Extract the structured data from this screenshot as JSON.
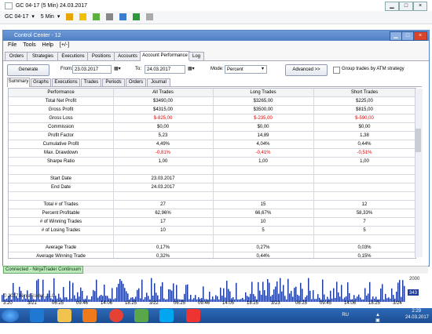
{
  "chart_window": {
    "title": "GC 04-17 (5 Min)  24.03.2017",
    "toolbar": {
      "instrument": "GC 04-17",
      "interval": "5 Min"
    }
  },
  "control_center": {
    "title": "Control Center - 12",
    "menu": [
      "File",
      "Tools",
      "Help",
      "[+/-]"
    ],
    "tabs": [
      "Orders",
      "Strategies",
      "Executions",
      "Positions",
      "Accounts",
      "Account Performance",
      "Log"
    ],
    "active_tab": "Account Performance",
    "generate_label": "Generate",
    "from_label": "From:",
    "from_value": "23.03.2017",
    "to_label": "To:",
    "to_value": "24.03.2017",
    "mode_label": "Mode:",
    "mode_value": "Percent",
    "advanced_label": "Advanced >>",
    "group_label": "Group trades by ATM strategy",
    "sub_tabs": [
      "Summary",
      "Graphs",
      "Executions",
      "Trades",
      "Periods",
      "Orders",
      "Journal"
    ],
    "active_sub_tab": "Summary",
    "table_headers": [
      "Performance",
      "All Trades",
      "Long Trades",
      "Short Trades"
    ],
    "rows": [
      {
        "label": "Total Net Profit",
        "all": "$3490,00",
        "long": "$3265,00",
        "short": "$225,00",
        "neg": false
      },
      {
        "label": "Gross Profit",
        "all": "$4315,00",
        "long": "$3500,00",
        "short": "$815,00",
        "neg": false
      },
      {
        "label": "Gross Loss",
        "all": "$-825,00",
        "long": "$-235,00",
        "short": "$-590,00",
        "neg": true
      },
      {
        "label": "Commission",
        "all": "$0,00",
        "long": "$0,00",
        "short": "$0,00",
        "neg": false
      },
      {
        "label": "Profit Factor",
        "all": "5,23",
        "long": "14,89",
        "short": "1,38",
        "neg": false
      },
      {
        "label": "Cumulative Profit",
        "all": "4,49%",
        "long": "4,04%",
        "short": "0,44%",
        "neg": false
      },
      {
        "label": "Max. Drawdown",
        "all": "-0,81%",
        "long": "-0,41%",
        "short": "-0,51%",
        "neg": true
      },
      {
        "label": "Sharpe Ratio",
        "all": "1,00",
        "long": "1,00",
        "short": "1,00",
        "neg": false
      },
      {
        "label": "",
        "all": "",
        "long": "",
        "short": "",
        "neg": false
      },
      {
        "label": "Start Date",
        "all": "23.03.2017",
        "long": "",
        "short": "",
        "neg": false
      },
      {
        "label": "End Date",
        "all": "24.03.2017",
        "long": "",
        "short": "",
        "neg": false
      },
      {
        "label": "",
        "all": "",
        "long": "",
        "short": "",
        "neg": false
      },
      {
        "label": "Total # of Trades",
        "all": "27",
        "long": "15",
        "short": "12",
        "neg": false
      },
      {
        "label": "Percent Profitable",
        "all": "62,96%",
        "long": "66,67%",
        "short": "58,33%",
        "neg": false
      },
      {
        "label": "# of Winning Trades",
        "all": "17",
        "long": "10",
        "short": "7",
        "neg": false
      },
      {
        "label": "# of Losing Trades",
        "all": "10",
        "long": "5",
        "short": "5",
        "neg": false
      },
      {
        "label": "",
        "all": "",
        "long": "",
        "short": "",
        "neg": false
      },
      {
        "label": "Average Trade",
        "all": "0,17%",
        "long": "0,27%",
        "short": "0,03%",
        "neg": false
      },
      {
        "label": "Average Winning Trade",
        "all": "0,32%",
        "long": "0,44%",
        "short": "0,15%",
        "neg": false
      },
      {
        "label": "Average Losing Trade",
        "all": "-0,12%",
        "long": "-0,09%",
        "short": "-0,15%",
        "neg": true
      }
    ]
  },
  "status": {
    "connection": "Connected - NinjaTrader Continuum"
  },
  "chart": {
    "price_label": "2000",
    "last_label": "343",
    "copyright": "© 2017 NinjaTrader, LLC",
    "time_labels": [
      "3:20",
      "3/21",
      "06:25",
      "09:46",
      "14:06",
      "18:25",
      "3/22",
      "06:25",
      "09:46",
      "14:05",
      "18:25",
      "3/23",
      "06:25",
      "09:45",
      "14:06",
      "18:25",
      "3/24"
    ]
  },
  "taskbar": {
    "language": "RU",
    "time": "2:29",
    "date": "24.03.2017"
  },
  "colors": {
    "title_blue": "#4f7fc3",
    "loss_red": "#e30000",
    "volume_blue": "#1e3c9c"
  }
}
